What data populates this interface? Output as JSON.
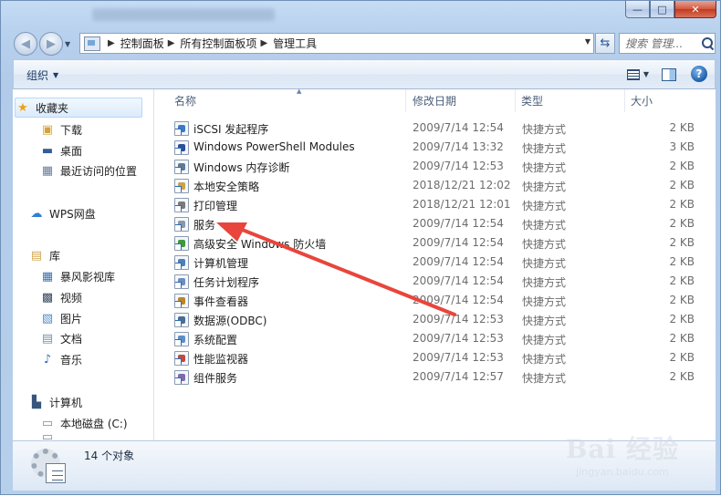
{
  "window": {
    "minimize": "—",
    "maximize": "□",
    "close": "✕"
  },
  "address": {
    "crumbs": [
      "控制面板",
      "所有控制面板项",
      "管理工具"
    ]
  },
  "search": {
    "placeholder": "搜索 管理..."
  },
  "toolbar": {
    "organize": "组织"
  },
  "nav": {
    "favorites": "收藏夹",
    "downloads": "下载",
    "desktop": "桌面",
    "recent": "最近访问的位置",
    "wps": "WPS网盘",
    "libraries": "库",
    "baofeng": "暴风影视库",
    "videos": "视频",
    "pictures": "图片",
    "documents": "文档",
    "music": "音乐",
    "computer": "计算机",
    "local_disk": "本地磁盘 (C:)"
  },
  "columns": {
    "name": "名称",
    "date": "修改日期",
    "type": "类型",
    "size": "大小"
  },
  "files": [
    {
      "name": "iSCSI 发起程序",
      "date": "2009/7/14 12:54",
      "type": "快捷方式",
      "size": "2 KB",
      "icon": "iscsi-icon",
      "color": "#3a7bc8"
    },
    {
      "name": "Windows PowerShell Modules",
      "date": "2009/7/14 13:32",
      "type": "快捷方式",
      "size": "3 KB",
      "icon": "powershell-icon",
      "color": "#2b4f9b"
    },
    {
      "name": "Windows 内存诊断",
      "date": "2009/7/14 12:53",
      "type": "快捷方式",
      "size": "2 KB",
      "icon": "memory-diagnostic-icon",
      "color": "#5f7a96"
    },
    {
      "name": "本地安全策略",
      "date": "2018/12/21 12:02",
      "type": "快捷方式",
      "size": "2 KB",
      "icon": "security-policy-icon",
      "color": "#c9a24a"
    },
    {
      "name": "打印管理",
      "date": "2018/12/21 12:01",
      "type": "快捷方式",
      "size": "2 KB",
      "icon": "printer-icon",
      "color": "#7a7a7a"
    },
    {
      "name": "服务",
      "date": "2009/7/14 12:54",
      "type": "快捷方式",
      "size": "2 KB",
      "icon": "services-gear-icon",
      "color": "#8a97a8"
    },
    {
      "name": "高级安全 Windows 防火墙",
      "date": "2009/7/14 12:54",
      "type": "快捷方式",
      "size": "2 KB",
      "icon": "firewall-icon",
      "color": "#3d9a3d"
    },
    {
      "name": "计算机管理",
      "date": "2009/7/14 12:54",
      "type": "快捷方式",
      "size": "2 KB",
      "icon": "computer-management-icon",
      "color": "#4f7fb8"
    },
    {
      "name": "任务计划程序",
      "date": "2009/7/14 12:54",
      "type": "快捷方式",
      "size": "2 KB",
      "icon": "task-scheduler-icon",
      "color": "#6a8ec0"
    },
    {
      "name": "事件查看器",
      "date": "2009/7/14 12:54",
      "type": "快捷方式",
      "size": "2 KB",
      "icon": "event-viewer-icon",
      "color": "#b8862b"
    },
    {
      "name": "数据源(ODBC)",
      "date": "2009/7/14 12:53",
      "type": "快捷方式",
      "size": "2 KB",
      "icon": "odbc-icon",
      "color": "#4a6d95"
    },
    {
      "name": "系统配置",
      "date": "2009/7/14 12:53",
      "type": "快捷方式",
      "size": "2 KB",
      "icon": "system-config-icon",
      "color": "#5c8fc9"
    },
    {
      "name": "性能监视器",
      "date": "2009/7/14 12:53",
      "type": "快捷方式",
      "size": "2 KB",
      "icon": "performance-monitor-icon",
      "color": "#c24a3a"
    },
    {
      "name": "组件服务",
      "date": "2009/7/14 12:57",
      "type": "快捷方式",
      "size": "2 KB",
      "icon": "component-services-icon",
      "color": "#7d6cb0"
    }
  ],
  "status": {
    "count": "14 个对象"
  },
  "watermark": {
    "main": "Bai 经验",
    "sub": "jingyan.baidu.com"
  },
  "colors": {
    "annotation_arrow": "#e8453c"
  }
}
